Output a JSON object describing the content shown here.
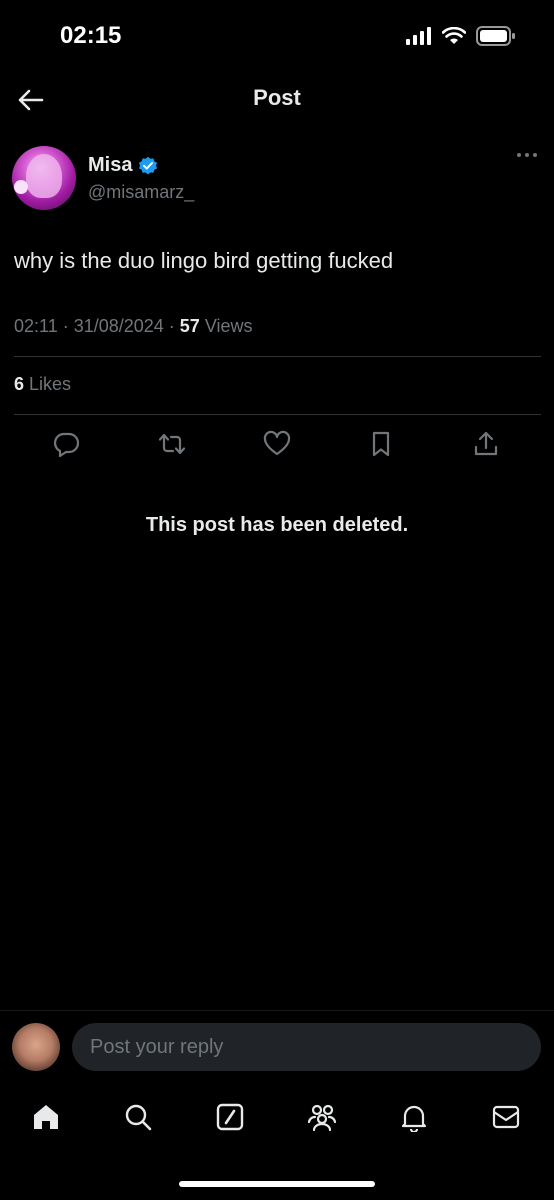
{
  "status_bar": {
    "time": "02:15"
  },
  "header": {
    "title": "Post"
  },
  "post": {
    "display_name": "Misa",
    "handle": "@misamarz_",
    "text": "why is the duo lingo bird getting fucked",
    "timestamp": "02:11 · 31/08/2024 · ",
    "views_count": "57",
    "views_label": " Views",
    "likes_count": "6",
    "likes_label": " Likes",
    "verified_color": "#1d9bf0"
  },
  "deleted_notice": "This post has been deleted.",
  "reply": {
    "placeholder": "Post your reply"
  },
  "nav": {
    "items": [
      "home-icon",
      "search-icon",
      "grok-icon",
      "communities-icon",
      "notifications-icon",
      "messages-icon"
    ]
  }
}
